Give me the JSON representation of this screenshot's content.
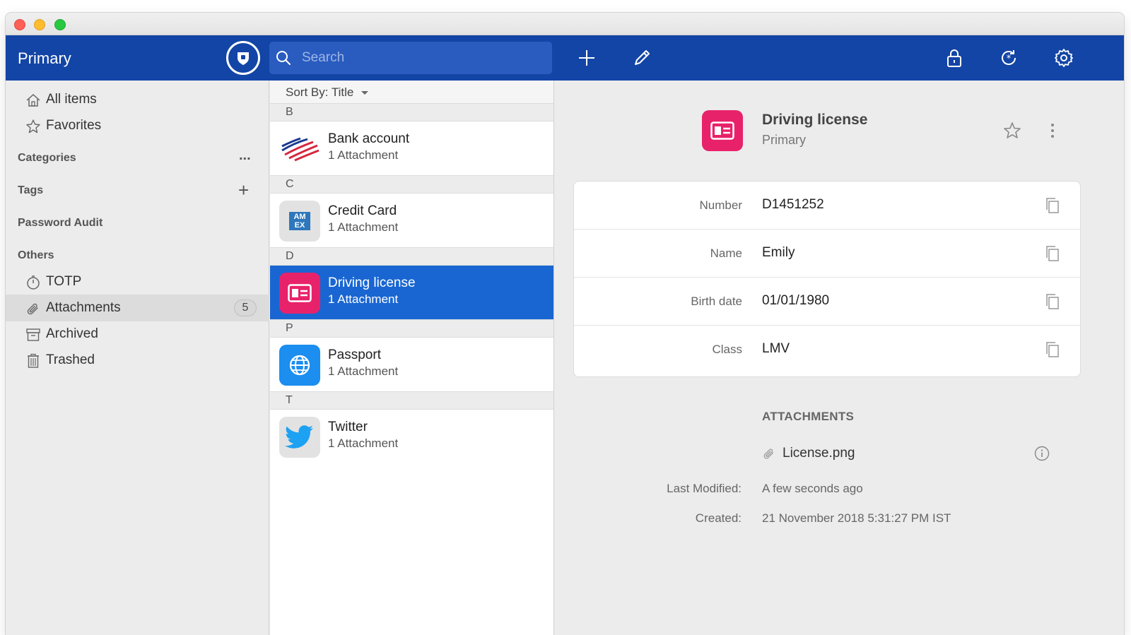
{
  "toolbar": {
    "vault_name": "Primary",
    "search_placeholder": "Search"
  },
  "sidebar": {
    "top_items": [
      {
        "label": "All items",
        "icon": "home-icon"
      },
      {
        "label": "Favorites",
        "icon": "star-icon"
      }
    ],
    "categories_label": "Categories",
    "categories_action": "...",
    "tags_label": "Tags",
    "tags_action": "+",
    "password_audit_label": "Password Audit",
    "others_label": "Others",
    "other_items": [
      {
        "label": "TOTP",
        "icon": "timer-icon"
      },
      {
        "label": "Attachments",
        "icon": "paperclip-icon",
        "count": "5",
        "active": true
      },
      {
        "label": "Archived",
        "icon": "archive-icon"
      },
      {
        "label": "Trashed",
        "icon": "trash-icon"
      }
    ]
  },
  "list": {
    "sort_label": "Sort By:",
    "sort_value": "Title",
    "groups": [
      {
        "letter": "B",
        "item": {
          "title": "Bank account",
          "subtitle": "1 Attachment",
          "icon": "bank-flag-icon"
        }
      },
      {
        "letter": "C",
        "item": {
          "title": "Credit Card",
          "subtitle": "1 Attachment",
          "icon": "amex-card-icon",
          "icon_text": "AM EX"
        }
      },
      {
        "letter": "D",
        "item": {
          "title": "Driving license",
          "subtitle": "1 Attachment",
          "icon": "id-card-icon",
          "selected": true
        }
      },
      {
        "letter": "P",
        "item": {
          "title": "Passport",
          "subtitle": "1 Attachment",
          "icon": "globe-icon"
        }
      },
      {
        "letter": "T",
        "item": {
          "title": "Twitter",
          "subtitle": "1 Attachment",
          "icon": "twitter-bird-icon"
        }
      }
    ]
  },
  "detail": {
    "title": "Driving license",
    "vault": "Primary",
    "fields": [
      {
        "label": "Number",
        "value": "D1451252"
      },
      {
        "label": "Name",
        "value": "Emily"
      },
      {
        "label": "Birth date",
        "value": "01/01/1980"
      },
      {
        "label": "Class",
        "value": "LMV"
      }
    ],
    "attachments_title": "ATTACHMENTS",
    "attachment_file": "License.png",
    "last_modified_label": "Last Modified:",
    "last_modified_value": "A few seconds ago",
    "created_label": "Created:",
    "created_value": "21 November 2018 5:31:27 PM IST"
  },
  "colors": {
    "toolbar_bg": "#1345a6",
    "selection_bg": "#1966d2",
    "id_card_pink": "#e8226a",
    "passport_blue": "#1b8ef0",
    "twitter_blue": "#1da1f2"
  }
}
